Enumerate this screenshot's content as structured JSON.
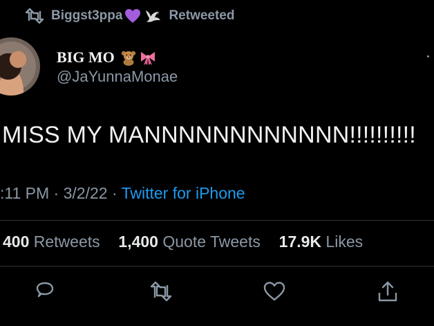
{
  "retweet_header": {
    "user": "Biggst3ppa",
    "status": "Retweeted",
    "emoji": [
      "purple-heart-icon",
      "dove-icon"
    ]
  },
  "author": {
    "display_name": "BIG MO",
    "handle": "@JaYunnaMonae",
    "name_emoji": [
      "teddy-bear-icon",
      "ribbon-icon"
    ]
  },
  "tweet": {
    "text": "MISS MY MANNNNNNNNNNNN!!!!!!!!!!",
    "time": ":11 PM",
    "date": "3/2/22",
    "separator": "·",
    "source": "Twitter for iPhone"
  },
  "stats": {
    "retweets_count": "400",
    "retweets_label": "Retweets",
    "quotes_count": "1,400",
    "quotes_label": "Quote Tweets",
    "likes_count": "17.9K",
    "likes_label": "Likes"
  },
  "actions": [
    "reply-icon",
    "retweet-icon",
    "like-icon",
    "share-icon"
  ],
  "colors": {
    "background": "#000000",
    "text": "#e7e9ea",
    "secondary": "#8b98a5",
    "link": "#1d9bf0",
    "divider": "#2f3336",
    "purple_heart": "#a35ddc",
    "ribbon": "#ee6f9c"
  }
}
